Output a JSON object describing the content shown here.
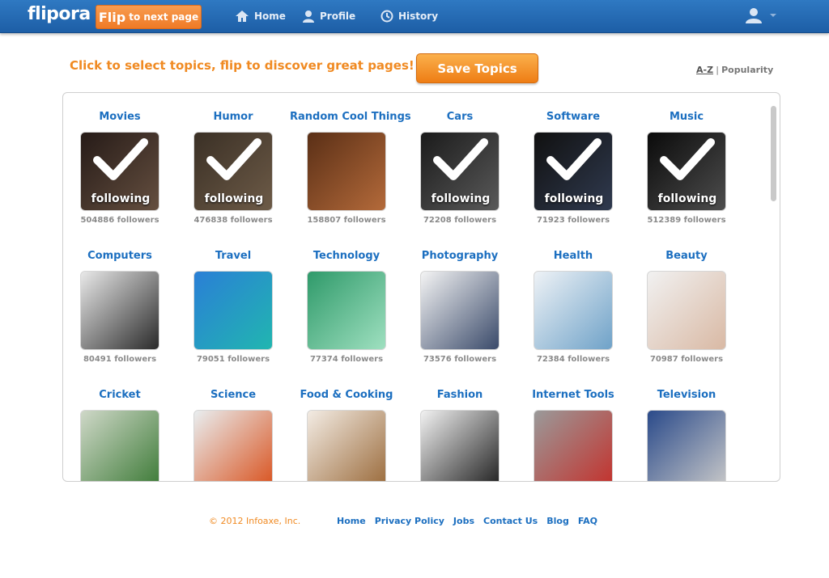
{
  "header": {
    "logo": "flipora",
    "flip_button": {
      "big": "Flip",
      "small": "to next page"
    },
    "nav": [
      {
        "label": "Home",
        "icon": "home-icon"
      },
      {
        "label": "Profile",
        "icon": "profile-icon"
      },
      {
        "label": "History",
        "icon": "clock-icon"
      }
    ],
    "user_icon": "user-icon"
  },
  "main": {
    "tagline": "Click to select topics, flip to discover great pages!",
    "save_button": "Save Topics",
    "sort": {
      "az": "A-Z",
      "separator": "|",
      "popularity": "Popularity"
    },
    "following_label": "following",
    "topics": [
      {
        "name": "Movies",
        "followers": "504886 followers",
        "following": true,
        "colors": [
          "#3b2a25",
          "#9b7a62"
        ]
      },
      {
        "name": "Humor",
        "followers": "476838 followers",
        "following": true,
        "colors": [
          "#5a4a3a",
          "#a88c6e"
        ]
      },
      {
        "name": "Random Cool Things",
        "followers": "158807 followers",
        "following": false,
        "colors": [
          "#5a2f16",
          "#b46a3a"
        ]
      },
      {
        "name": "Cars",
        "followers": "72208 followers",
        "following": true,
        "colors": [
          "#2a2a2a",
          "#8a8a8a"
        ]
      },
      {
        "name": "Software",
        "followers": "71923 followers",
        "following": true,
        "colors": [
          "#1a1a1a",
          "#4a5a7a"
        ]
      },
      {
        "name": "Music",
        "followers": "512389 followers",
        "following": true,
        "colors": [
          "#111111",
          "#777777"
        ]
      },
      {
        "name": "Computers",
        "followers": "80491 followers",
        "following": false,
        "colors": [
          "#e9e9e9",
          "#2a2a2a"
        ]
      },
      {
        "name": "Travel",
        "followers": "79051 followers",
        "following": false,
        "colors": [
          "#2a7fd6",
          "#21b6b0"
        ]
      },
      {
        "name": "Technology",
        "followers": "77374 followers",
        "following": false,
        "colors": [
          "#2f9a6a",
          "#9fe0c0"
        ]
      },
      {
        "name": "Photography",
        "followers": "73576 followers",
        "following": false,
        "colors": [
          "#f4f4f4",
          "#3a4a6a"
        ]
      },
      {
        "name": "Health",
        "followers": "72384 followers",
        "following": false,
        "colors": [
          "#eef2f6",
          "#6fa2c8"
        ]
      },
      {
        "name": "Beauty",
        "followers": "70987 followers",
        "following": false,
        "colors": [
          "#f1f1f1",
          "#d9b9a4"
        ]
      },
      {
        "name": "Cricket",
        "followers": "",
        "following": false,
        "colors": [
          "#cfd8c8",
          "#3c7a36"
        ]
      },
      {
        "name": "Science",
        "followers": "",
        "following": false,
        "colors": [
          "#e9eef0",
          "#d9521e"
        ]
      },
      {
        "name": "Food & Cooking",
        "followers": "",
        "following": false,
        "colors": [
          "#f3ece4",
          "#9a6a3a"
        ]
      },
      {
        "name": "Fashion",
        "followers": "",
        "following": false,
        "colors": [
          "#f2f2f2",
          "#1e1e1e"
        ]
      },
      {
        "name": "Internet Tools",
        "followers": "",
        "following": false,
        "colors": [
          "#9a9a9a",
          "#c4302b"
        ]
      },
      {
        "name": "Television",
        "followers": "",
        "following": false,
        "colors": [
          "#2a4a8a",
          "#c9c9c9"
        ]
      }
    ]
  },
  "footer": {
    "copyright": "© 2012 Infoaxe, Inc.",
    "links": [
      "Home",
      "Privacy Policy",
      "Jobs",
      "Contact Us",
      "Blog",
      "FAQ"
    ]
  },
  "colors": {
    "header_blue": "#2567b1",
    "accent_orange": "#f08a22",
    "link_blue": "#1c6fc0"
  }
}
